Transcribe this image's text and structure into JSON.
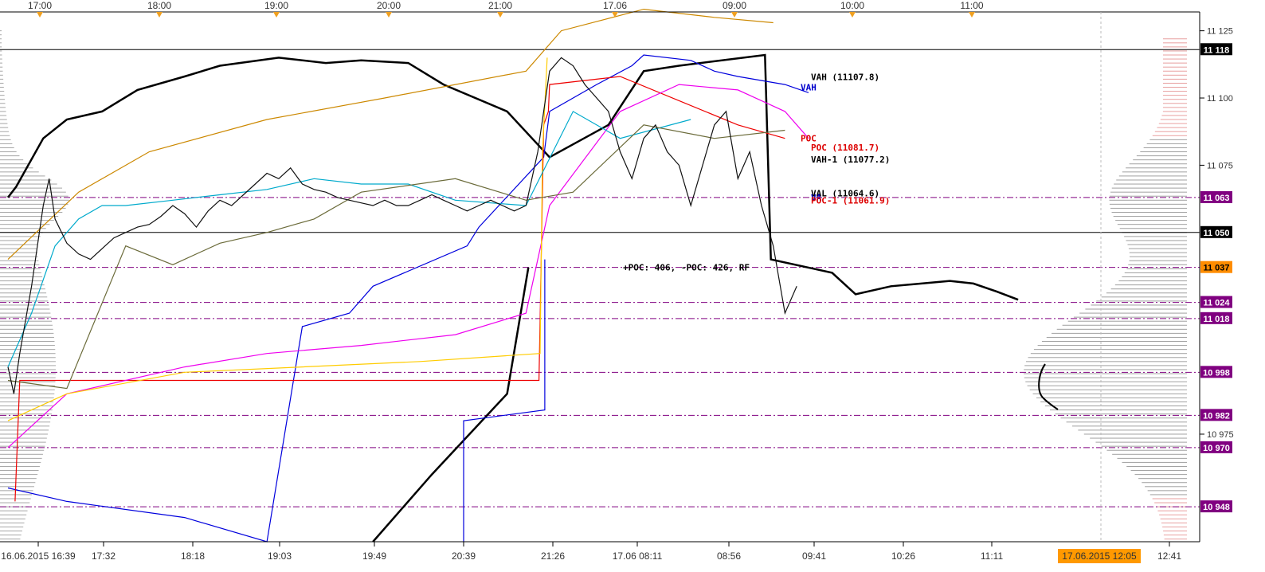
{
  "chart_data": {
    "type": "line",
    "title": "",
    "xlabel": "",
    "ylabel": "",
    "ylim": [
      10935,
      11132
    ],
    "top_time_ticks": [
      "17:00",
      "18:00",
      "19:00",
      "20:00",
      "21:00",
      "17.06",
      "09:00",
      "10:00",
      "11:00"
    ],
    "bottom_time_ticks": [
      "16.06.2015 16:39",
      "17:32",
      "18:18",
      "19:03",
      "19:49",
      "20:39",
      "21:26",
      "17.06 08:11",
      "08:56",
      "09:41",
      "10:26",
      "11:11",
      "12:41"
    ],
    "current_time_label": "17.06.2015 12:05",
    "y_axis_ticks": [
      "11 125",
      "11 100",
      "11 075",
      "10 975"
    ],
    "y_axis_tick_values": [
      11125,
      11100,
      11075,
      10975
    ],
    "level_labels": [
      {
        "text": "11 118",
        "value": 11118,
        "bg": "#000000",
        "fg": "#ffffff"
      },
      {
        "text": "11 063",
        "value": 11063,
        "bg": "#800080",
        "fg": "#ffffff"
      },
      {
        "text": "11 050",
        "value": 11050,
        "bg": "#000000",
        "fg": "#ffffff"
      },
      {
        "text": "11 037",
        "value": 11037,
        "bg": "#ff8c00",
        "fg": "#000000"
      },
      {
        "text": "11 024",
        "value": 11024,
        "bg": "#800080",
        "fg": "#ffffff"
      },
      {
        "text": "11 018",
        "value": 11018,
        "bg": "#800080",
        "fg": "#ffffff"
      },
      {
        "text": "10 998",
        "value": 10998,
        "bg": "#800080",
        "fg": "#ffffff"
      },
      {
        "text": "10 982",
        "value": 10982,
        "bg": "#800080",
        "fg": "#ffffff"
      },
      {
        "text": "10 970",
        "value": 10970,
        "bg": "#800080",
        "fg": "#ffffff"
      },
      {
        "text": "10 948",
        "value": 10948,
        "bg": "#800080",
        "fg": "#ffffff"
      }
    ],
    "horizontal_levels": [
      {
        "value": 11118,
        "style": "solid",
        "color": "#000000"
      },
      {
        "value": 11050,
        "style": "solid",
        "color": "#000000"
      },
      {
        "value": 11063,
        "style": "dashdot",
        "color": "#800080"
      },
      {
        "value": 11037,
        "style": "dashdot",
        "color": "#800080"
      },
      {
        "value": 11024,
        "style": "dashdot",
        "color": "#800080"
      },
      {
        "value": 11018,
        "style": "dashdot",
        "color": "#800080"
      },
      {
        "value": 10998,
        "style": "dashdot",
        "color": "#800080"
      },
      {
        "value": 10982,
        "style": "dashdot",
        "color": "#800080"
      },
      {
        "value": 10970,
        "style": "dashdot",
        "color": "#800080"
      },
      {
        "value": 10948,
        "style": "dashdot",
        "color": "#800080"
      }
    ],
    "annotations": [
      {
        "text": "VAH (11107.8)",
        "value": 11107.8,
        "color": "#000000"
      },
      {
        "text": "VAH",
        "value": 11104,
        "color": "#0000cc"
      },
      {
        "text": "POC",
        "value": 11085,
        "color": "#dd0000"
      },
      {
        "text": "POC (11081.7)",
        "value": 11081.7,
        "color": "#dd0000"
      },
      {
        "text": "VAH-1 (11077.2)",
        "value": 11077.2,
        "color": "#000000"
      },
      {
        "text": "VAL (11064.6)",
        "value": 11064.6,
        "color": "#000000"
      },
      {
        "text": "VA",
        "value": 11063,
        "color": "#0000cc"
      },
      {
        "text": "POC-1 (11061.9)",
        "value": 11061.9,
        "color": "#dd0000"
      },
      {
        "text": "+POC: 406, -POC: 426, RF",
        "value": 11037,
        "color": "#000000"
      }
    ],
    "series": [
      {
        "color": "#000000",
        "t": [
          0,
          0.7,
          3,
          5,
          8,
          11,
          15,
          18,
          23,
          27,
          30,
          34,
          37,
          42.4,
          46,
          51,
          54,
          57,
          64.3,
          64.8,
          70,
          72,
          75,
          80,
          82,
          84,
          85.8
        ],
        "values": [
          11063,
          11067,
          11085,
          11092,
          11095,
          11103,
          11108,
          11112,
          11115,
          11113,
          11114,
          11113,
          11105,
          11095,
          11078,
          11090,
          11110,
          11112,
          11116,
          11040,
          11035,
          11027,
          11030,
          11032,
          11031,
          11028,
          11025
        ]
      },
      {
        "color": "#000000",
        "t": [
          31,
          36,
          42.4,
          44.2
        ],
        "values": [
          10935,
          10960,
          10990,
          11037
        ]
      },
      {
        "color": "#0000dd",
        "t": [
          0,
          5,
          15,
          22,
          25,
          29,
          31,
          31,
          39,
          40,
          45.5,
          45.5,
          46,
          50,
          53,
          54,
          58,
          60,
          62,
          66,
          68
        ],
        "values": [
          10955,
          10950,
          10944,
          10935,
          11015,
          11020,
          11030,
          11030,
          11045,
          11052,
          11078,
          11078,
          11095,
          11105,
          11112,
          11116,
          11114,
          11110,
          11108,
          11105,
          11102
        ]
      },
      {
        "color": "#0000dd",
        "t": [
          38.7,
          38.7,
          45.6,
          45.6
        ],
        "values": [
          10935,
          10980,
          10984,
          11040
        ]
      },
      {
        "color": "#ee0000",
        "t": [
          0.6,
          1,
          45.1,
          45.5,
          45.9,
          46,
          52,
          62,
          66
        ],
        "values": [
          10950,
          10995,
          10995,
          11090,
          11095,
          11105,
          11108,
          11090,
          11085
        ]
      },
      {
        "color": "#ee00ee",
        "t": [
          0,
          5,
          15,
          22,
          30,
          34,
          38,
          44,
          46,
          52,
          57,
          62,
          66,
          68
        ],
        "values": [
          10970,
          10990,
          11000,
          11005,
          11008,
          11010,
          11012,
          11020,
          11060,
          11095,
          11105,
          11103,
          11095,
          11085
        ]
      },
      {
        "color": "#ffcc00",
        "t": [
          0,
          5,
          15,
          25,
          35,
          45.2,
          45.4,
          45.8
        ],
        "values": [
          10980,
          10990,
          10998,
          11000,
          11002,
          11005,
          11080,
          11115
        ]
      },
      {
        "color": "#cc8800",
        "t": [
          0,
          6,
          12,
          22,
          32,
          44,
          47,
          54,
          60,
          65
        ],
        "values": [
          11040,
          11065,
          11080,
          11092,
          11100,
          11110,
          11125,
          11133,
          11130,
          11128
        ]
      },
      {
        "color": "#00aacc",
        "t": [
          0,
          2,
          4,
          6,
          8,
          10,
          14,
          18,
          22,
          26,
          30,
          34,
          38,
          44,
          48,
          52,
          58
        ],
        "values": [
          11000,
          11020,
          11045,
          11055,
          11060,
          11060,
          11062,
          11064,
          11066,
          11070,
          11068,
          11068,
          11062,
          11060,
          11095,
          11085,
          11092
        ]
      },
      {
        "color": "#6b6b3a",
        "t": [
          0,
          5,
          10,
          14,
          18,
          22,
          26,
          30,
          38,
          44,
          48,
          54,
          60,
          66
        ],
        "values": [
          10995,
          10992,
          11045,
          11038,
          11046,
          11050,
          11055,
          11065,
          11070,
          11062,
          11065,
          11090,
          11085,
          11088
        ]
      },
      {
        "color": "#111111",
        "t": [
          0,
          0.5,
          1,
          2,
          3,
          3.5,
          4,
          5,
          6,
          7,
          8,
          9,
          10,
          11,
          12,
          13,
          14,
          15,
          16,
          17,
          18,
          19,
          20,
          21,
          22,
          23,
          24,
          25,
          26,
          27,
          28,
          29,
          30,
          31,
          32,
          33,
          34,
          35,
          36,
          37,
          38,
          39,
          40,
          41,
          42,
          43,
          44,
          45,
          46,
          47,
          48,
          49,
          50,
          51,
          52,
          53,
          54,
          55,
          56,
          57,
          58,
          59,
          60,
          61,
          62,
          63,
          64,
          65,
          66,
          67
        ],
        "values": [
          11000,
          10990,
          11005,
          11030,
          11060,
          11070,
          11055,
          11046,
          11042,
          11040,
          11044,
          11048,
          11050,
          11052,
          11053,
          11056,
          11060,
          11057,
          11052,
          11058,
          11062,
          11060,
          11064,
          11068,
          11072,
          11070,
          11074,
          11068,
          11066,
          11065,
          11063,
          11062,
          11061,
          11060,
          11062,
          11060,
          11060,
          11062,
          11064,
          11062,
          11060,
          11058,
          11060,
          11062,
          11060,
          11058,
          11060,
          11080,
          11110,
          11115,
          11112,
          11105,
          11100,
          11095,
          11080,
          11070,
          11085,
          11090,
          11080,
          11075,
          11060,
          11075,
          11090,
          11095,
          11070,
          11080,
          11060,
          11045,
          11020,
          11030
        ]
      }
    ],
    "volume_profile_left": {
      "peak_value": 11000,
      "color": "#808080"
    },
    "volume_profile_right": {
      "peak_value": 10998,
      "color": "#808080",
      "top_color": "#e08080"
    },
    "grid": false,
    "legend": "none"
  }
}
